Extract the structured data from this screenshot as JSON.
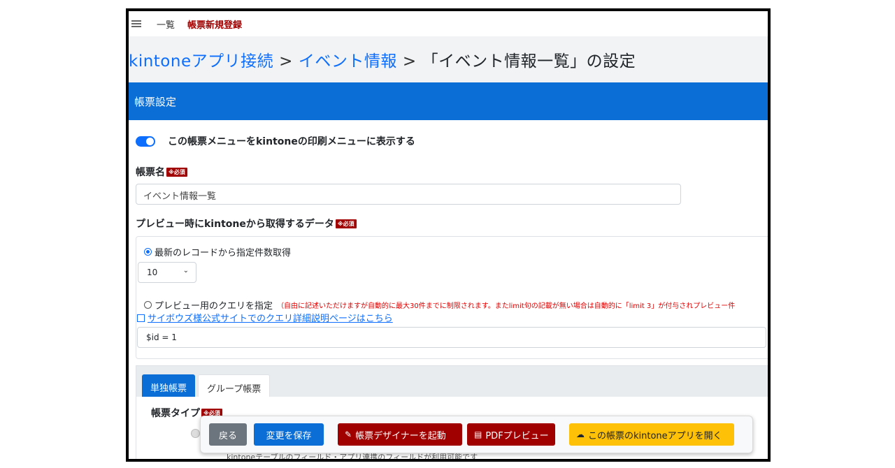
{
  "nav": {
    "hamburger_icon": "hamburger-menu-icon",
    "list_link": "一覧",
    "current": "帳票新規登録"
  },
  "breadcrumb": {
    "item1": "kintoneアプリ接続",
    "sep": ">",
    "item2": "イベント情報",
    "current": "「イベント情報一覧」の設定"
  },
  "section_title": "帳票設定",
  "toggle": {
    "label": "この帳票メニューをkintoneの印刷メニューに表示する",
    "on": true
  },
  "required_badge": "※必須",
  "report_name": {
    "label": "帳票名",
    "value": "イベント情報一覧"
  },
  "preview_data": {
    "label": "プレビュー時にkintoneから取得するデータ",
    "option_latest": "最新のレコードから指定件数取得",
    "count_value": "10",
    "option_query": "プレビュー用のクエリを指定",
    "query_note": "（自由に記述いただけますが自動的に最大30件までに制限されます。またlimit句の記載が無い場合は自動的に「limit 3」が付与されプレビュー件",
    "help_link": "サイボウズ様公式サイトでのクエリ詳細説明ページはこちら",
    "query_value": "$id = 1"
  },
  "tabs": {
    "single": "単独帳票",
    "group": "グループ帳票"
  },
  "report_type": {
    "label": "帳票タイプ"
  },
  "footer_hint": "kintoneテーブルのフィールド・アプリ連携のフィールドが利用可能です",
  "actions": {
    "back": "戻る",
    "save": "変更を保存",
    "designer": "帳票デザイナーを起動",
    "pdf": "PDFプレビュー",
    "open_app": "この帳票のkintoneアプリを開く"
  },
  "colors": {
    "primary": "#0a6ed6",
    "danger": "#a00000",
    "warning": "#ffc107",
    "secondary": "#6c757d"
  }
}
